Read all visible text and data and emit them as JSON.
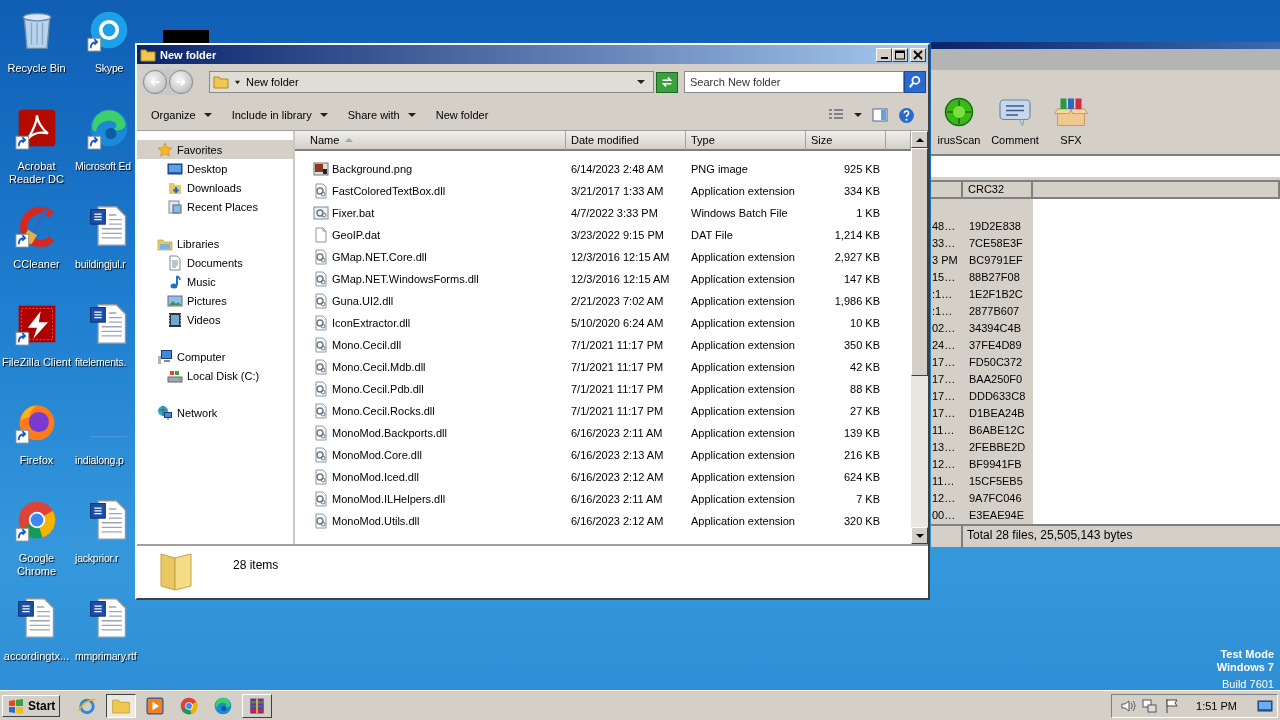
{
  "desktop": {
    "icons": [
      {
        "label": "Recycle Bin",
        "kind": "recycle",
        "shortcut": false
      },
      {
        "label": "Acrobat Reader DC",
        "kind": "acrobat",
        "shortcut": true
      },
      {
        "label": "CCleaner",
        "kind": "ccleaner",
        "shortcut": true
      },
      {
        "label": "FileZilla Client",
        "kind": "filezilla",
        "shortcut": true
      },
      {
        "label": "Firefox",
        "kind": "firefox",
        "shortcut": true
      },
      {
        "label": "Google Chrome",
        "kind": "chrome",
        "shortcut": true
      },
      {
        "label": "accordingtx...",
        "kind": "word",
        "shortcut": false
      },
      {
        "label": "Skype",
        "kind": "skype",
        "shortcut": true
      },
      {
        "label": "Microsoft Ed",
        "kind": "edge",
        "shortcut": true
      },
      {
        "label": "buildingjul.r",
        "kind": "word",
        "shortcut": false
      },
      {
        "label": "fitelements.",
        "kind": "word",
        "shortcut": false
      },
      {
        "label": "indialong.p",
        "kind": "blank",
        "shortcut": false
      },
      {
        "label": "jackprior.r",
        "kind": "word",
        "shortcut": false
      },
      {
        "label": "mmprimary.rtf",
        "kind": "word",
        "shortcut": false
      }
    ],
    "notice": {
      "mode": "Test Mode",
      "os": "Windows 7",
      "build": "Build 7601"
    }
  },
  "archiver_window": {
    "tools": [
      {
        "label": "irusScan",
        "kind": "virus"
      },
      {
        "label": "Comment",
        "kind": "comment"
      },
      {
        "label": "SFX",
        "kind": "sfx"
      }
    ],
    "columns": [
      "CRC32"
    ],
    "rows": [
      {
        "column_1": "48…",
        "crc": "19D2E838"
      },
      {
        "column_1": "33…",
        "crc": "7CE58E3F"
      },
      {
        "column_1": "3 PM",
        "crc": "BC9791EF"
      },
      {
        "column_1": "15…",
        "crc": "88B27F08"
      },
      {
        "column_1": ":1…",
        "crc": "1E2F1B2C"
      },
      {
        "column_1": ":1…",
        "crc": "2877B607"
      },
      {
        "column_1": "02…",
        "crc": "34394C4B"
      },
      {
        "column_1": "24…",
        "crc": "37FE4D89"
      },
      {
        "column_1": "17…",
        "crc": "FD50C372"
      },
      {
        "column_1": "17…",
        "crc": "BAA250F0"
      },
      {
        "column_1": "17…",
        "crc": "DDD633C8"
      },
      {
        "column_1": "17…",
        "crc": "D1BEA24B"
      },
      {
        "column_1": "11…",
        "crc": "B6ABE12C"
      },
      {
        "column_1": "13…",
        "crc": "2FEBBE2D"
      },
      {
        "column_1": "12…",
        "crc": "BF9941FB"
      },
      {
        "column_1": "11…",
        "crc": "15CF5EB5"
      },
      {
        "column_1": "12…",
        "crc": "9A7FC046"
      },
      {
        "column_1": "00…",
        "crc": "E3EAE94E"
      }
    ],
    "status": "Total 28 files, 25,505,143 bytes"
  },
  "explorer_window": {
    "title": "New folder",
    "address": "New folder",
    "search": {
      "placeholder": "Search New folder"
    },
    "toolbar": [
      {
        "label": "Organize",
        "dropdown": true
      },
      {
        "label": "Include in library",
        "dropdown": true
      },
      {
        "label": "Share with",
        "dropdown": true
      },
      {
        "label": "New folder",
        "dropdown": false
      }
    ],
    "nav": [
      {
        "label": "Favorites",
        "kind": "star",
        "selected": true,
        "children": [
          {
            "label": "Desktop",
            "kind": "desktop",
            "selected": false
          },
          {
            "label": "Downloads",
            "kind": "downloads",
            "selected": false
          },
          {
            "label": "Recent Places",
            "kind": "recent",
            "selected": false
          }
        ]
      },
      {
        "label": "Libraries",
        "kind": "library",
        "selected": false,
        "children": [
          {
            "label": "Documents",
            "kind": "document",
            "selected": false
          },
          {
            "label": "Music",
            "kind": "music",
            "selected": false
          },
          {
            "label": "Pictures",
            "kind": "pictures",
            "selected": false
          },
          {
            "label": "Videos",
            "kind": "videos",
            "selected": false
          }
        ]
      },
      {
        "label": "Computer",
        "kind": "computer",
        "selected": false,
        "children": [
          {
            "label": "Local Disk (C:)",
            "kind": "disk",
            "selected": false
          }
        ]
      },
      {
        "label": "Network",
        "kind": "network",
        "selected": false
      }
    ],
    "columns": [
      {
        "label": "Name",
        "sorted": true
      },
      {
        "label": "Date modified",
        "sorted": false
      },
      {
        "label": "Type",
        "sorted": false
      },
      {
        "label": "Size",
        "sorted": false
      }
    ],
    "files": [
      {
        "name": "Background.png",
        "kind": "image",
        "date": "6/14/2023 2:48 AM",
        "type": "PNG image",
        "size": "925 KB"
      },
      {
        "name": "FastColoredTextBox.dll",
        "kind": "dll",
        "date": "3/21/2017 1:33 AM",
        "type": "Application extension",
        "size": "334 KB"
      },
      {
        "name": "Fixer.bat",
        "kind": "bat",
        "date": "4/7/2022 3:33 PM",
        "type": "Windows Batch File",
        "size": "1 KB"
      },
      {
        "name": "GeoIP.dat",
        "kind": "file",
        "date": "3/23/2022 9:15 PM",
        "type": "DAT File",
        "size": "1,214 KB"
      },
      {
        "name": "GMap.NET.Core.dll",
        "kind": "dll",
        "date": "12/3/2016 12:15 AM",
        "type": "Application extension",
        "size": "2,927 KB"
      },
      {
        "name": "GMap.NET.WindowsForms.dll",
        "kind": "dll",
        "date": "12/3/2016 12:15 AM",
        "type": "Application extension",
        "size": "147 KB"
      },
      {
        "name": "Guna.UI2.dll",
        "kind": "dll",
        "date": "2/21/2023 7:02 AM",
        "type": "Application extension",
        "size": "1,986 KB"
      },
      {
        "name": "IconExtractor.dll",
        "kind": "dll",
        "date": "5/10/2020 6:24 AM",
        "type": "Application extension",
        "size": "10 KB"
      },
      {
        "name": "Mono.Cecil.dll",
        "kind": "dll",
        "date": "7/1/2021 11:17 PM",
        "type": "Application extension",
        "size": "350 KB"
      },
      {
        "name": "Mono.Cecil.Mdb.dll",
        "kind": "dll",
        "date": "7/1/2021 11:17 PM",
        "type": "Application extension",
        "size": "42 KB"
      },
      {
        "name": "Mono.Cecil.Pdb.dll",
        "kind": "dll",
        "date": "7/1/2021 11:17 PM",
        "type": "Application extension",
        "size": "88 KB"
      },
      {
        "name": "Mono.Cecil.Rocks.dll",
        "kind": "dll",
        "date": "7/1/2021 11:17 PM",
        "type": "Application extension",
        "size": "27 KB"
      },
      {
        "name": "MonoMod.Backports.dll",
        "kind": "dll",
        "date": "6/16/2023 2:11 AM",
        "type": "Application extension",
        "size": "139 KB"
      },
      {
        "name": "MonoMod.Core.dll",
        "kind": "dll",
        "date": "6/16/2023 2:13 AM",
        "type": "Application extension",
        "size": "216 KB"
      },
      {
        "name": "MonoMod.Iced.dll",
        "kind": "dll",
        "date": "6/16/2023 2:12 AM",
        "type": "Application extension",
        "size": "624 KB"
      },
      {
        "name": "MonoMod.ILHelpers.dll",
        "kind": "dll",
        "date": "6/16/2023 2:11 AM",
        "type": "Application extension",
        "size": "7 KB"
      },
      {
        "name": "MonoMod.Utils.dll",
        "kind": "dll",
        "date": "6/16/2023 2:12 AM",
        "type": "Application extension",
        "size": "320 KB"
      }
    ],
    "details": {
      "count": "28 items"
    }
  },
  "taskbar": {
    "start": "Start",
    "apps": [
      {
        "kind": "ie",
        "open": false,
        "selected": false
      },
      {
        "kind": "explorer",
        "open": true,
        "selected": true
      },
      {
        "kind": "media",
        "open": false,
        "selected": false
      },
      {
        "kind": "chrome",
        "open": false,
        "selected": false
      },
      {
        "kind": "edge",
        "open": false,
        "selected": false
      },
      {
        "kind": "winrar",
        "open": true,
        "selected": false
      }
    ],
    "clock": "1:51 PM"
  }
}
